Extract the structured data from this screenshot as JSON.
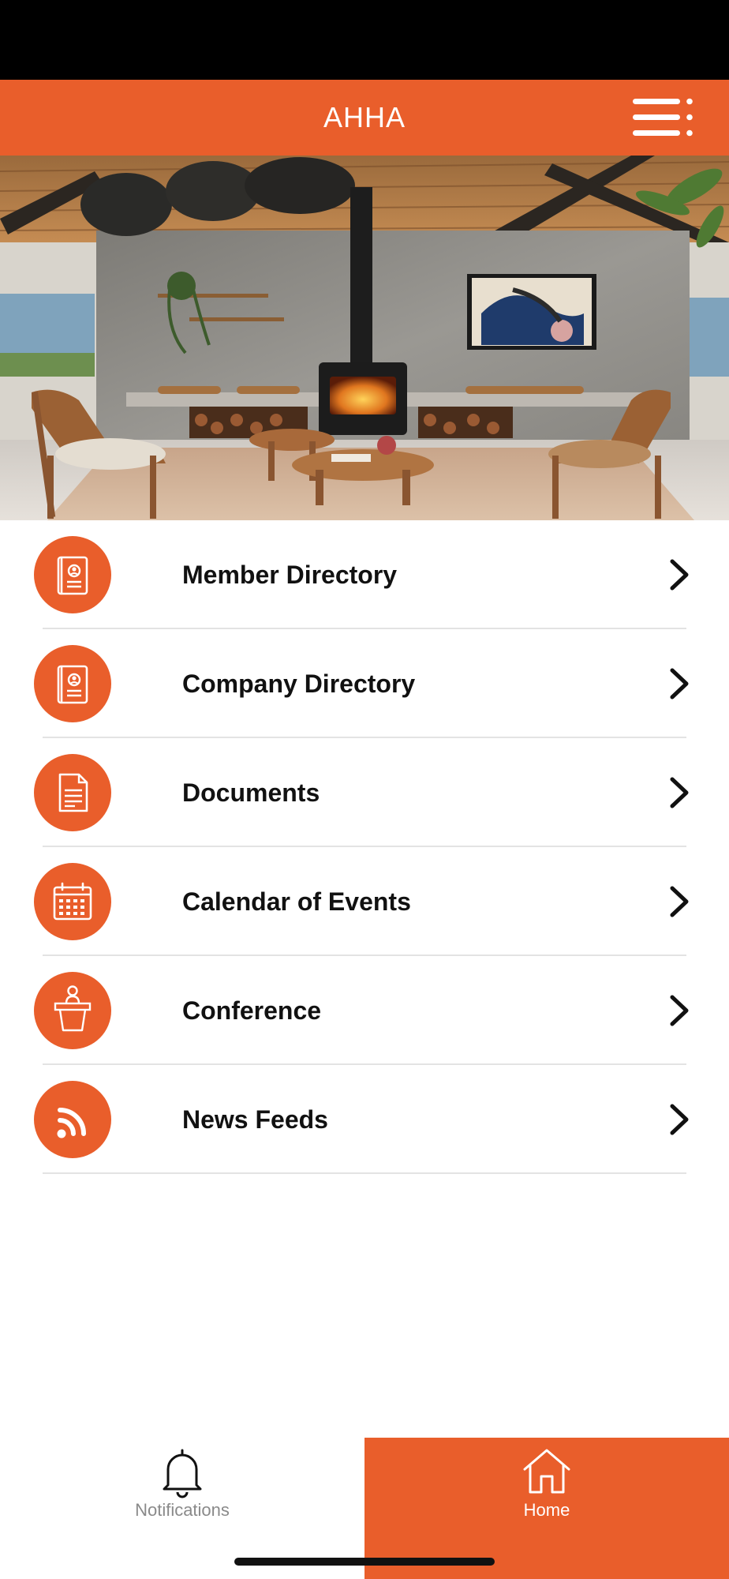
{
  "header": {
    "title": "AHHA",
    "menu_icon": "hamburger-menu-icon"
  },
  "hero": {
    "description_icon": "living-room-photo"
  },
  "menu": {
    "items": [
      {
        "label": "Member Directory",
        "icon": "contact-book-icon"
      },
      {
        "label": "Company Directory",
        "icon": "contact-book-icon"
      },
      {
        "label": "Documents",
        "icon": "document-icon"
      },
      {
        "label": "Calendar of Events",
        "icon": "calendar-icon"
      },
      {
        "label": "Conference",
        "icon": "podium-speaker-icon"
      },
      {
        "label": "News Feeds",
        "icon": "rss-feed-icon"
      }
    ]
  },
  "bottom_nav": {
    "notifications_label": "Notifications",
    "home_label": "Home",
    "active": "Home"
  },
  "colors": {
    "accent": "#E95E2B",
    "status_bar": "#000000",
    "text": "#111111",
    "inactive_nav_text": "#8a8a8a"
  }
}
